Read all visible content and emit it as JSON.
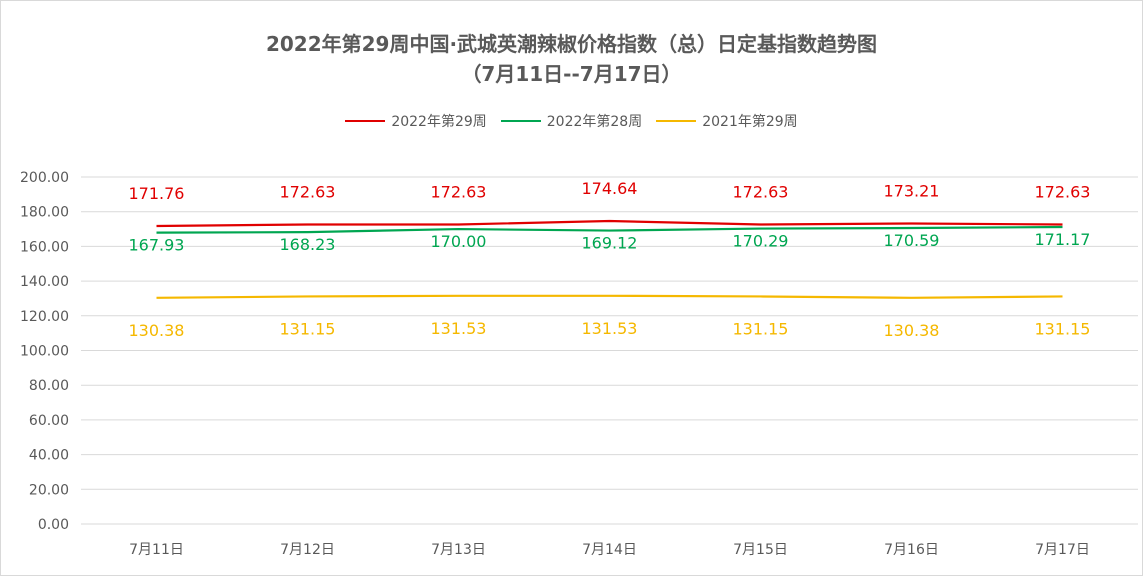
{
  "chart_data": {
    "type": "line",
    "title_line1": "2022年第29周中国·武城英潮辣椒价格指数（总）日定基指数趋势图",
    "title_line2": "（7月11日--7月17日）",
    "categories": [
      "7月11日",
      "7月12日",
      "7月13日",
      "7月14日",
      "7月15日",
      "7月16日",
      "7月17日"
    ],
    "y_ticks": [
      "0.00",
      "20.00",
      "40.00",
      "60.00",
      "80.00",
      "100.00",
      "120.00",
      "140.00",
      "160.00",
      "180.00",
      "200.00"
    ],
    "ylim": [
      0,
      200
    ],
    "grid": true,
    "legend_position": "top-center",
    "series": [
      {
        "name": "2022年第29周",
        "color": "#e00000",
        "values": [
          171.76,
          172.63,
          172.63,
          174.64,
          172.63,
          173.21,
          172.63
        ],
        "labels": [
          "171.76",
          "172.63",
          "172.63",
          "174.64",
          "172.63",
          "173.21",
          "172.63"
        ]
      },
      {
        "name": "2022年第28周",
        "color": "#00a651",
        "values": [
          167.93,
          168.23,
          170.0,
          169.12,
          170.29,
          170.59,
          171.17
        ],
        "labels": [
          "167.93",
          "168.23",
          "170.00",
          "169.12",
          "170.29",
          "170.59",
          "171.17"
        ]
      },
      {
        "name": "2021年第29周",
        "color": "#f5b800",
        "values": [
          130.38,
          131.15,
          131.53,
          131.53,
          131.15,
          130.38,
          131.15
        ],
        "labels": [
          "130.38",
          "131.15",
          "131.53",
          "131.53",
          "131.15",
          "130.38",
          "131.15"
        ]
      }
    ]
  }
}
